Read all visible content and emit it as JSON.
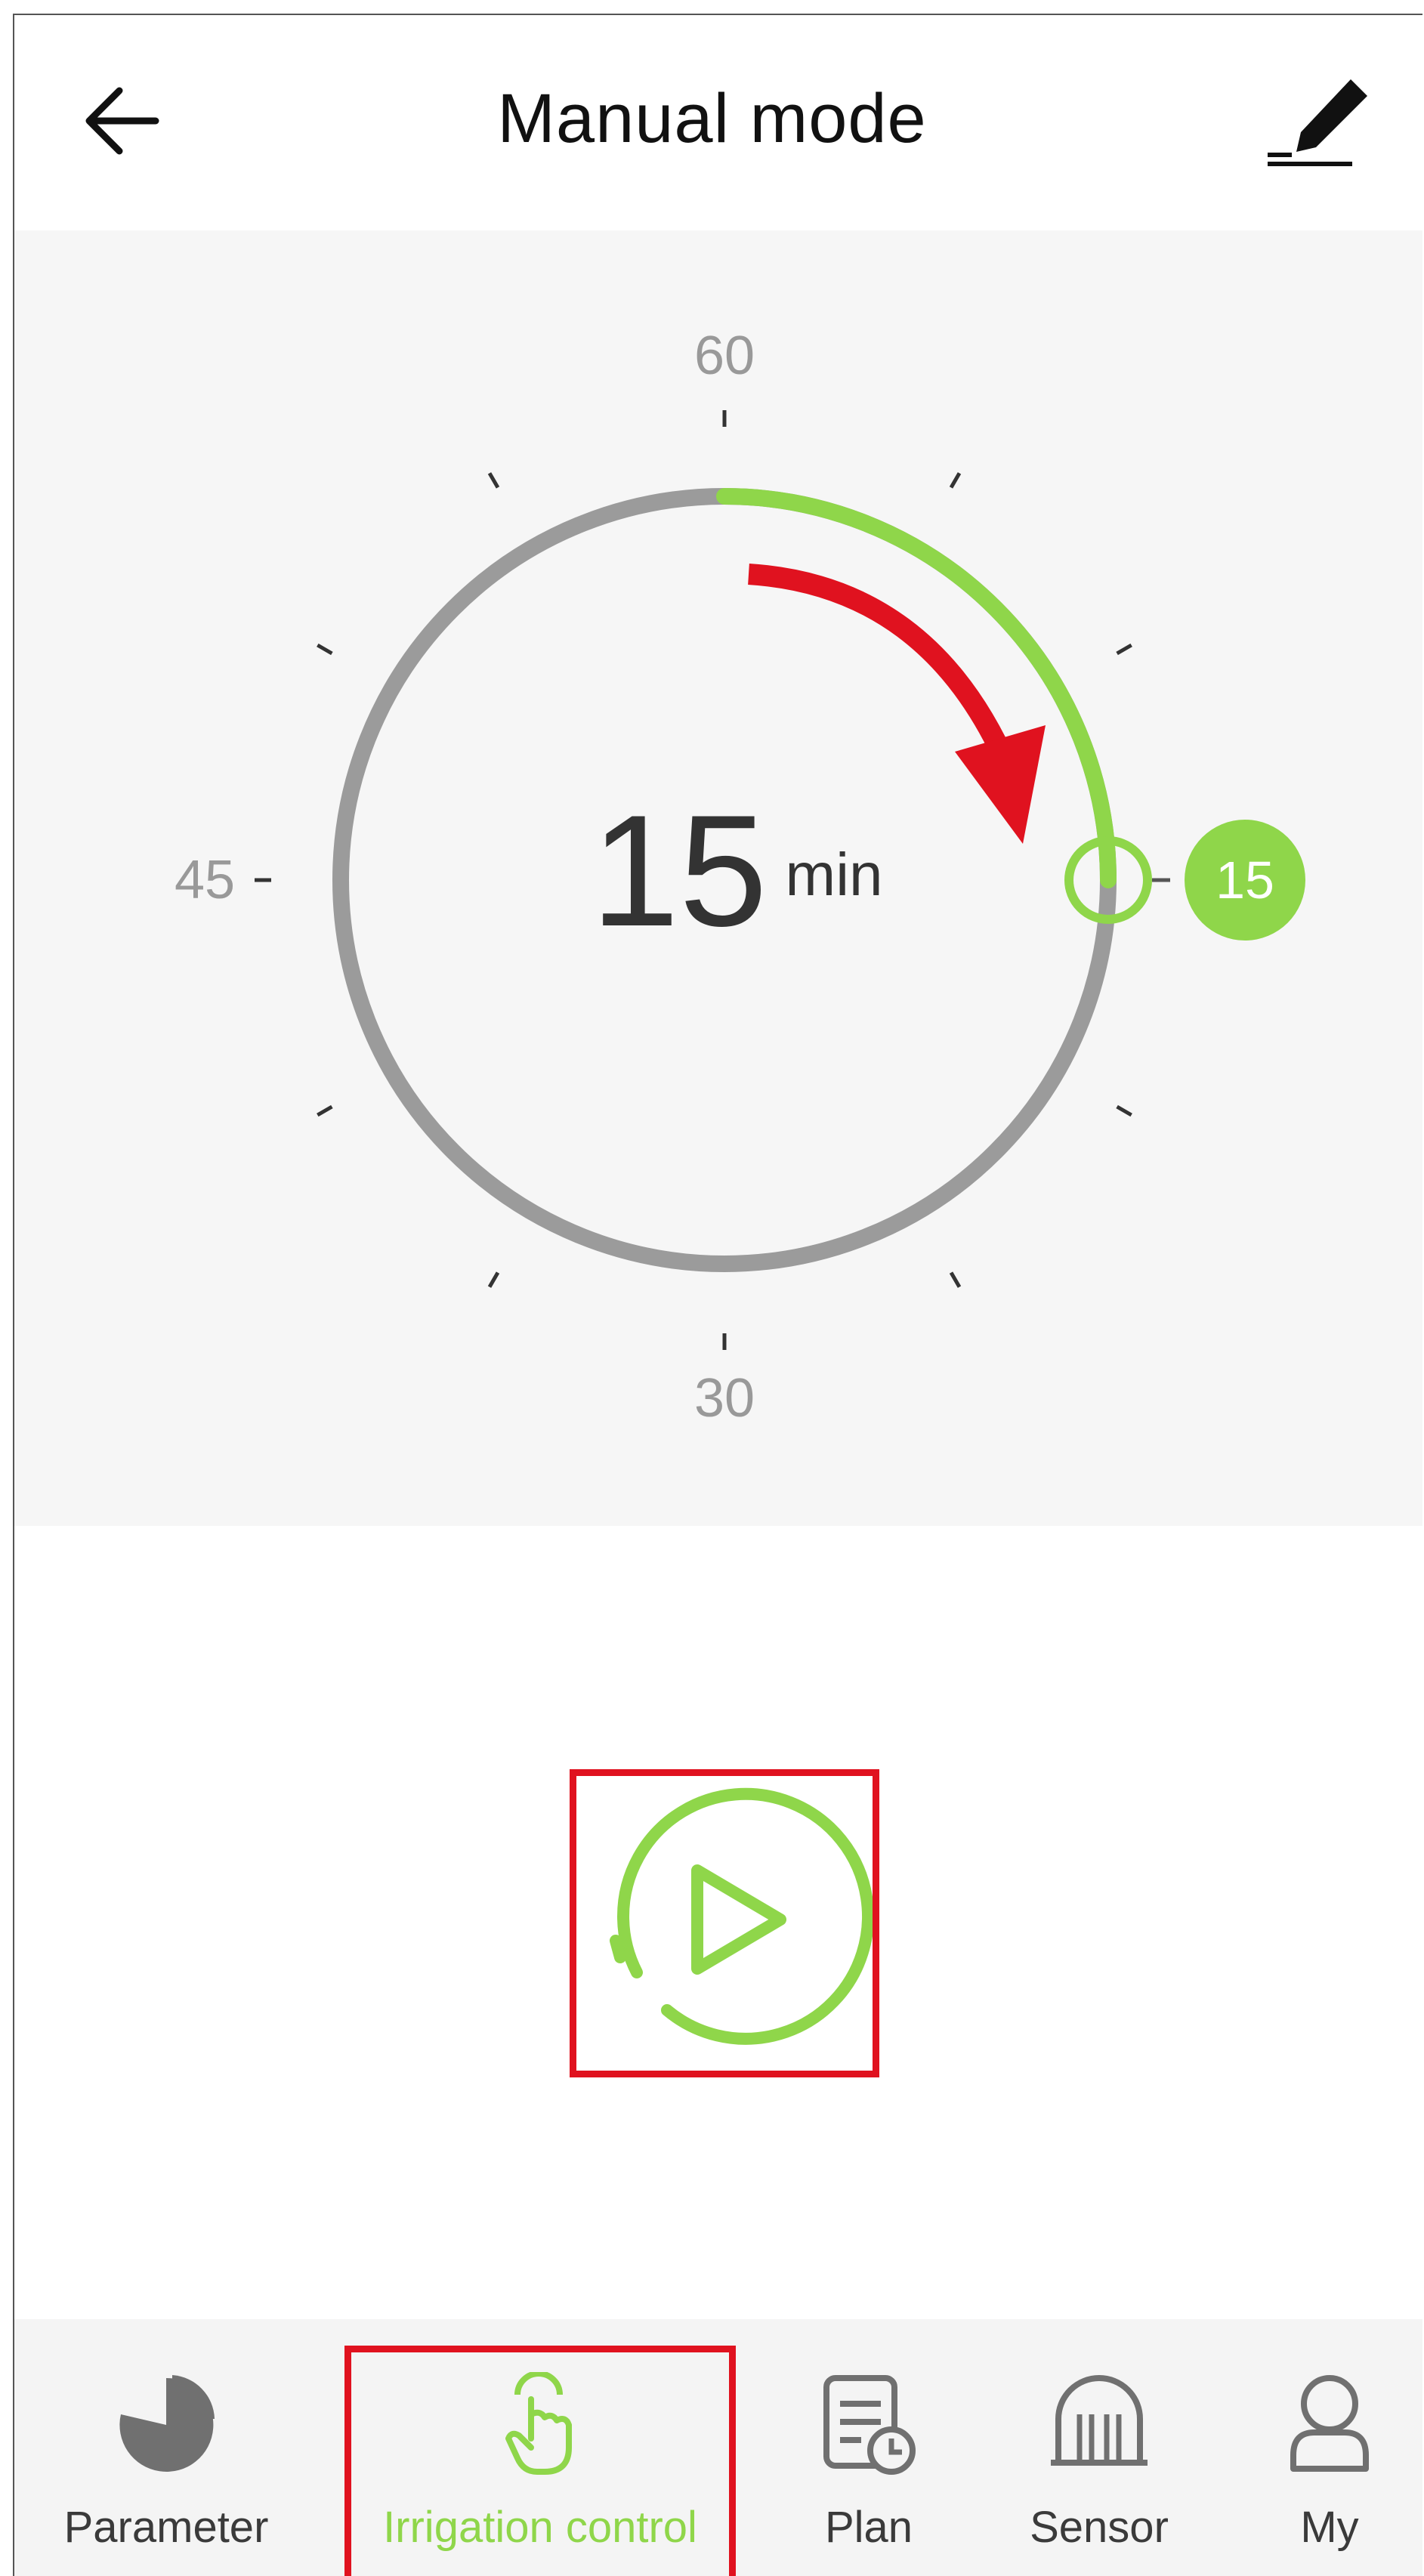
{
  "header": {
    "title": "Manual mode"
  },
  "dial": {
    "value": "15",
    "unit": "min",
    "marker_value": "15",
    "scale_labels": {
      "top": "60",
      "left": "45",
      "bottom": "30"
    },
    "selected_minutes": 15,
    "max_minutes": 60,
    "colors": {
      "progress": "#8fd64a",
      "track": "#9b9b9b",
      "arrow": "#e0121f",
      "text": "#333333"
    }
  },
  "play": {
    "icon": "play-circle-icon"
  },
  "tabs": [
    {
      "label": "Parameter",
      "icon": "pie-chart-icon"
    },
    {
      "label": "Irrigation control",
      "icon": "hand-touch-icon",
      "active": true
    },
    {
      "label": "Plan",
      "icon": "document-clock-icon"
    },
    {
      "label": "Sensor",
      "icon": "sensor-icon"
    },
    {
      "label": "My",
      "icon": "user-icon"
    }
  ]
}
